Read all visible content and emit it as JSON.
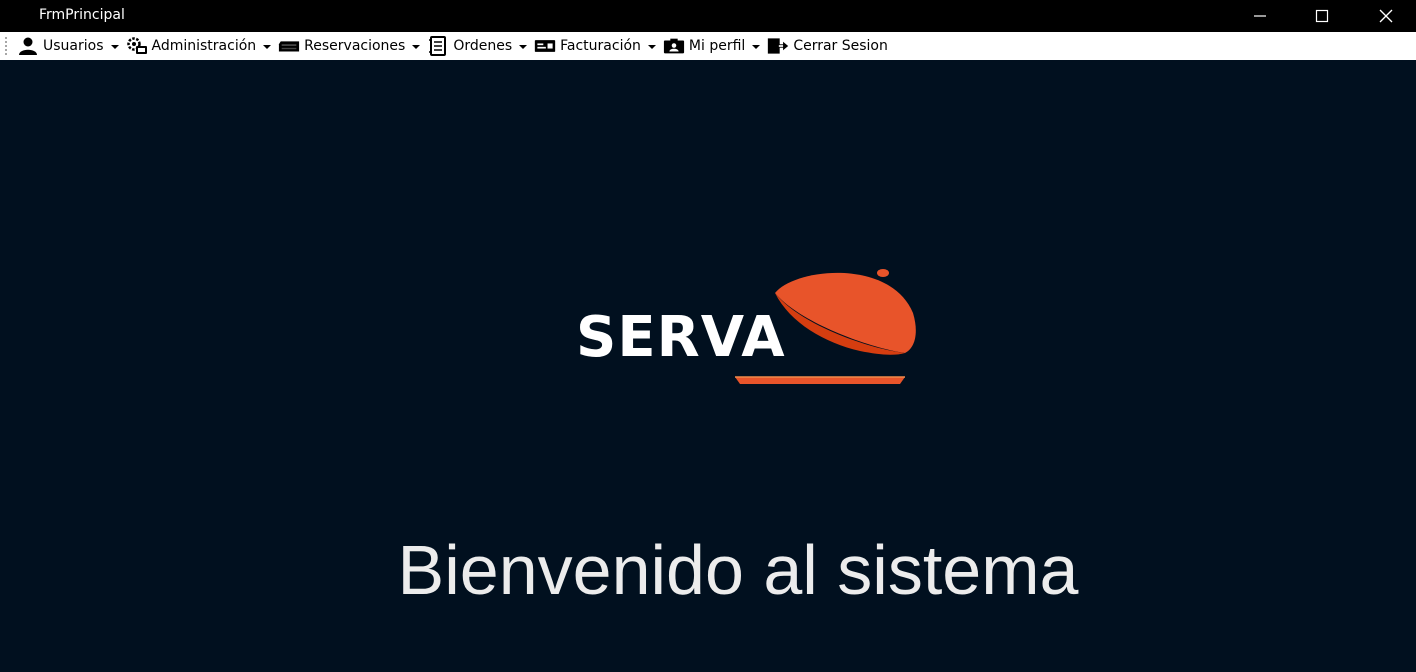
{
  "window": {
    "title": "FrmPrincipal",
    "controls": {
      "minimize": "minimize-icon",
      "maximize": "maximize-icon",
      "close": "close-icon"
    }
  },
  "menu": {
    "items": [
      {
        "label": "Usuarios",
        "icon": "user-icon",
        "has_dropdown": true
      },
      {
        "label": "Administración",
        "icon": "admin-gears-icon",
        "has_dropdown": true
      },
      {
        "label": "Reservaciones",
        "icon": "reservations-icon",
        "has_dropdown": true
      },
      {
        "label": "Ordenes",
        "icon": "orders-notebook-icon",
        "has_dropdown": true
      },
      {
        "label": "Facturación",
        "icon": "billing-card-icon",
        "has_dropdown": true
      },
      {
        "label": "Mi perfil",
        "icon": "profile-card-icon",
        "has_dropdown": true
      },
      {
        "label": "Cerrar Sesion",
        "icon": "logout-icon",
        "has_dropdown": false
      }
    ]
  },
  "main": {
    "logo_text": "SERVA",
    "welcome": "Bienvenido al sistema"
  },
  "colors": {
    "background": "#01101f",
    "titlebar": "#000000",
    "menubar": "#ffffff",
    "logo_orange": "#e8542a",
    "logo_dark_orange": "#d53d10",
    "text_light": "#ececec"
  }
}
